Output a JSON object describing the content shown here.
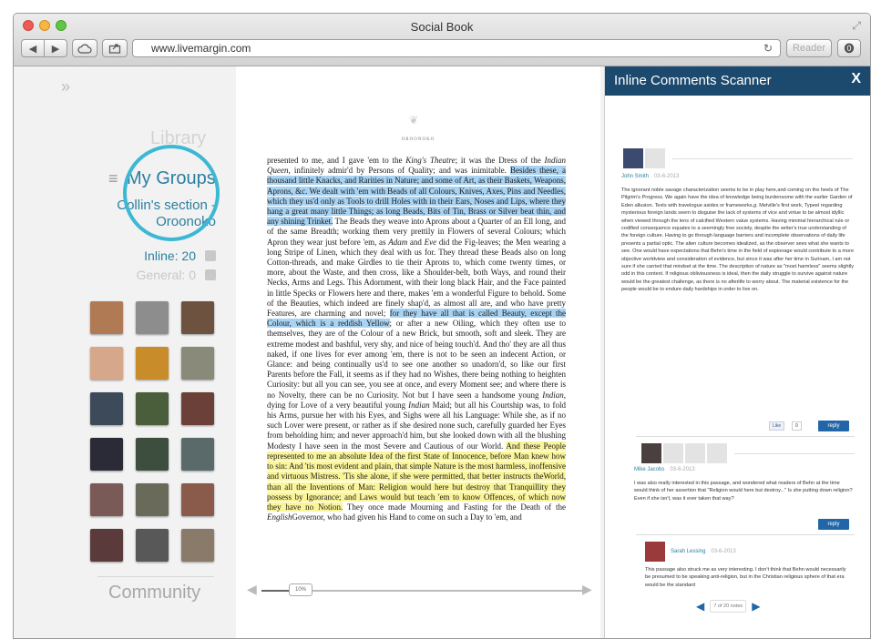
{
  "browser": {
    "window_title": "Social Book",
    "url": "www.livemargin.com",
    "reader_label": "Reader"
  },
  "sidebar": {
    "library": "Library",
    "my_groups": "My Groups",
    "section": "Collin's section -",
    "book": "Oroonoko",
    "inline_label": "Inline: 20",
    "general_label": "General: 0",
    "community": "Community",
    "avatar_colors": [
      "#b07a55",
      "#8d8d8d",
      "#6e5240",
      "#d6a78a",
      "#c88d2a",
      "#8a8a7a",
      "#3d4a5a",
      "#4a5e3c",
      "#6b4038",
      "#2b2b38",
      "#3e4e3e",
      "#5a6a6a",
      "#7a5a56",
      "#6a6a5a",
      "#8a5a4a",
      "#5a3a3a",
      "#585858",
      "#8a7a6a"
    ]
  },
  "book": {
    "running_head": "OROONOKO",
    "progress_percent": 10,
    "progress_label": "10%",
    "text": {
      "p1": "presented to me, and I gave 'em to the ",
      "p1i": "King's Theatre",
      "p2": "; it was the Dress of the ",
      "p2i": "Indian Queen",
      "p3": ", infinitely admir'd by Persons of Quality; and was inimitable. ",
      "h1": "Besides these, a thousand little Knacks, and Rarities in Nature; and some of Art, as their Baskets, Weapons, Aprons, &c. We dealt with 'em with Beads of all Colours, Knives, Axes, Pins and Needles, which they us'd only as Tools to drill Holes with in their Ears, Noses and Lips, where they hang a great many little Things; as long Beads, Bits of Tin, Brass or Silver beat thin, and any shining Trinket.",
      "p4": " The Beads they weave into Aprons about a Quarter of an Ell long, and of the same Breadth; working them very prettily in Flowers of several Colours; which Apron they wear just before 'em, as ",
      "p4i1": "Adam",
      "p4b": " and ",
      "p4i2": "Eve",
      "p5": " did the Fig-leaves; the Men wearing a long Stripe of Linen, which they deal with us for. They thread these Beads also on long Cotton-threads, and make Girdles to tie their Aprons to, which come twenty times, or more, about the Waste, and then cross, like a Shoulder-belt, both Ways, and round their Necks, Arms and Legs. This Adornment, with their long black Hair, and the Face painted in little Specks or Flowers here and there, makes 'em a wonderful Figure to behold. Some of the Beauties, which indeed are finely shap'd, as almost all are, and who have pretty Features, are charming and novel; ",
      "h2": "for they have all that is called Beauty, except the Colour, which is a reddish Yellow",
      "p6": "; or after a new Oiling, which they often use to themselves, they are of the Colour of a new Brick, but smooth, soft and sleek. They are extreme modest and bashful, very shy, and nice of being touch'd. And tho' they are all thus naked, if one lives for ever among 'em, there is not to be seen an indecent Action, or Glance: and being continually us'd to see one another so unadorn'd, so like our first Parents before the Fall, it seems as if they had no Wishes, there being nothing to heighten Curiosity: but all you can see, you see at once, and every Moment see; and where there is no Novelty, there can be no Curiosity. Not but I have seen a handsome young ",
      "p6i": "Indian",
      "p7": ", dying for Love of a very beautiful young ",
      "p7i": "Indian",
      "p8": " Maid; but all his Courtship was, to fold his Arms, pursue her with his Eyes, and Sighs were all his Language: While she, as if no such Lover were present, or rather as if she desired none such, carefully guarded her Eyes from beholding him; and never approach'd him, but she looked down with all the blushing Modesty I have seen in the most Severe and Cautious of our World. ",
      "h3": "And these People represented to me an absolute Idea of the first State of Innocence, before Man knew how to sin: And 'tis most evident and plain, that simple Nature is the most harmless, inoffensive and virtuous Mistress. 'Tis she alone, if she were permitted, that better instructs theWorld, than all the Inventions of Man: Religion would here but destroy that Tranquillity they possess by Ignorance; and Laws would but teach 'em to know Offences, of which now they have no Notion.",
      "p9": " They once made Mourning and Fasting for the Death of the ",
      "p9i": "English",
      "p10": "Governor, who had given his Hand to come on such a Day to 'em, and"
    }
  },
  "comments": {
    "panel_title": "Inline Comments Scanner",
    "close_label": "X",
    "c1": {
      "author": "John Smith",
      "date": "03-6-2013",
      "text": "The ignorant noble savage characterization seems to be in play here,and coming on the heels of The Pilgrim's Progress. We again have the idea of knowledge being burdensome with the earlier Garden of Eden allusion. Texts with travelogue asides or frameworks,g. Melville's first work, Typeel regarding mysterious foreign lands seem to disguise the lack of systems of vice and virtue to be almost idyllic when viewed through the lens of calcified Western value systems. Having minimal hierarchical rule or codified consequence equates to a seemingly free society, despite the writer's true understanding of the foreign culture. Having to go through language barriers and incomplete observations of daily life presents a partial optic. The alien culture becomes idealized, as the observer sees what she wants to see. One would have expectations that Behn's time in the field of espionage would contribute to a more objective worldview and consideration of evidence, but since it was after her time in Surinam, I am not sure if she carried that mindset at the time. The description of nature as \"most harmless\" seems slightly odd in this context. If religious obliviousness is ideal, then the daily struggle to survive against nature would be the greatest challenge, as there is no afterlife to worry about. The material existence for the people would be to endure daily hardships in order to live on.",
      "like_label": "Like",
      "like_count": "0",
      "reply_label": "reply"
    },
    "c2": {
      "author": "Mike Jacobs",
      "date": "03-6-2013",
      "text": "I was also really interested in this passage, and wondered what readers of Behn at the time would think of her assertion that \"Religion would here but destroy...\" Is she putting down religion? Even if she isn't, was it ever taken that way?",
      "reply_label": "reply"
    },
    "c3": {
      "author": "Sarah Lessing",
      "date": "03-6-2013",
      "text": "This passage also struck me as very interesting. I don't think that Behn would necessarily be presumed to be speaking anti-religion, but in the Christian religious sphere of that era would be the standard"
    },
    "pager_label": "7 of 20 notes"
  }
}
